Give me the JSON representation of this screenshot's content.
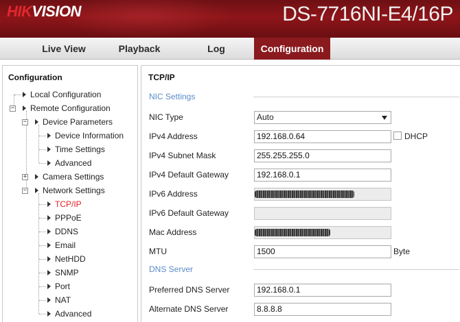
{
  "header": {
    "logo_part1": "HIK",
    "logo_part2": "VISION",
    "model": "DS-7716NI-E4/16P"
  },
  "nav": {
    "items": [
      "Live View",
      "Playback",
      "Log",
      "Configuration"
    ],
    "active": "Configuration"
  },
  "sidebar": {
    "title": "Configuration",
    "tree": {
      "local": "Local Configuration",
      "remote": "Remote Configuration",
      "device_params": "Device Parameters",
      "device_info": "Device Information",
      "time_settings": "Time Settings",
      "advanced_1": "Advanced",
      "camera_settings": "Camera Settings",
      "network_settings": "Network Settings",
      "tcpip": "TCP/IP",
      "pppoe": "PPPoE",
      "ddns": "DDNS",
      "email": "Email",
      "nethdd": "NetHDD",
      "snmp": "SNMP",
      "port": "Port",
      "nat": "NAT",
      "advanced_2": "Advanced"
    }
  },
  "main": {
    "title": "TCP/IP",
    "nic_section": "NIC Settings",
    "dns_section": "DNS Server",
    "fields": {
      "nic_type": {
        "label": "NIC Type",
        "value": "Auto"
      },
      "ipv4_address": {
        "label": "IPv4 Address",
        "value": "192.168.0.64"
      },
      "dhcp": {
        "label": "DHCP",
        "checked": false
      },
      "ipv4_mask": {
        "label": "IPv4 Subnet Mask",
        "value": "255.255.255.0"
      },
      "ipv4_gateway": {
        "label": "IPv4 Default Gateway",
        "value": "192.168.0.1"
      },
      "ipv6_address": {
        "label": "IPv6 Address",
        "value": ""
      },
      "ipv6_gateway": {
        "label": "IPv6 Default Gateway",
        "value": ""
      },
      "mac_address": {
        "label": "Mac Address",
        "value": ""
      },
      "mtu": {
        "label": "MTU",
        "value": "1500",
        "unit": "Byte"
      },
      "preferred_dns": {
        "label": "Preferred DNS Server",
        "value": "192.168.0.1"
      },
      "alternate_dns": {
        "label": "Alternate DNS Server",
        "value": "8.8.8.8"
      }
    }
  },
  "colors": {
    "header_red": "#8e1519",
    "active_tab": "#8a1a1e",
    "section_blue": "#5a8cc8",
    "selected_tree": "#e02020"
  }
}
